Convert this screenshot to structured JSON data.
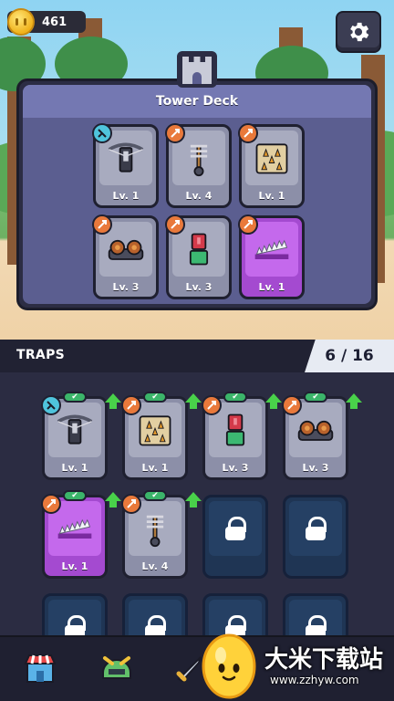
{
  "hud": {
    "coins": "461"
  },
  "deck": {
    "title": "Tower Deck",
    "cards": [
      {
        "icon": "crossbow-icon",
        "type": "turret",
        "level": "Lv. 1",
        "rarity": "common"
      },
      {
        "icon": "spike-pillar-icon",
        "type": "trap",
        "level": "Lv. 4",
        "rarity": "common"
      },
      {
        "icon": "spike-floor-icon",
        "type": "trap",
        "level": "Lv. 1",
        "rarity": "common"
      },
      {
        "icon": "roller-trap-icon",
        "type": "trap",
        "level": "Lv. 3",
        "rarity": "common"
      },
      {
        "icon": "piston-trap-icon",
        "type": "trap",
        "level": "Lv. 3",
        "rarity": "common"
      },
      {
        "icon": "saw-blade-icon",
        "type": "trap",
        "level": "Lv. 1",
        "rarity": "epic"
      }
    ]
  },
  "traps": {
    "label": "TRAPS",
    "count": "6 / 16",
    "cards": [
      {
        "icon": "crossbow-icon",
        "type": "turret",
        "level": "Lv. 1",
        "rarity": "common",
        "equipped": true,
        "upgrade": true
      },
      {
        "icon": "spike-floor-icon",
        "type": "trap",
        "level": "Lv. 1",
        "rarity": "common",
        "equipped": true,
        "upgrade": true
      },
      {
        "icon": "piston-trap-icon",
        "type": "trap",
        "level": "Lv. 3",
        "rarity": "common",
        "equipped": true,
        "upgrade": true
      },
      {
        "icon": "roller-trap-icon",
        "type": "trap",
        "level": "Lv. 3",
        "rarity": "common",
        "equipped": true,
        "upgrade": true
      },
      {
        "icon": "saw-blade-icon",
        "type": "trap",
        "level": "Lv. 1",
        "rarity": "epic",
        "equipped": true,
        "upgrade": true
      },
      {
        "icon": "spike-pillar-icon",
        "type": "trap",
        "level": "Lv. 4",
        "rarity": "common",
        "equipped": true,
        "upgrade": true
      },
      {
        "icon": "locked-icon",
        "type": "locked"
      },
      {
        "icon": "locked-icon",
        "type": "locked"
      },
      {
        "icon": "locked-icon",
        "type": "locked"
      },
      {
        "icon": "locked-icon",
        "type": "locked"
      },
      {
        "icon": "locked-icon",
        "type": "locked"
      },
      {
        "icon": "locked-icon",
        "type": "locked"
      }
    ]
  },
  "nav": {
    "items": [
      {
        "icon": "shop-icon"
      },
      {
        "icon": "helmet-icon"
      },
      {
        "icon": "sword-icon"
      }
    ]
  },
  "watermark": {
    "text": "大米下载站",
    "url": "www.zzhyw.com"
  }
}
